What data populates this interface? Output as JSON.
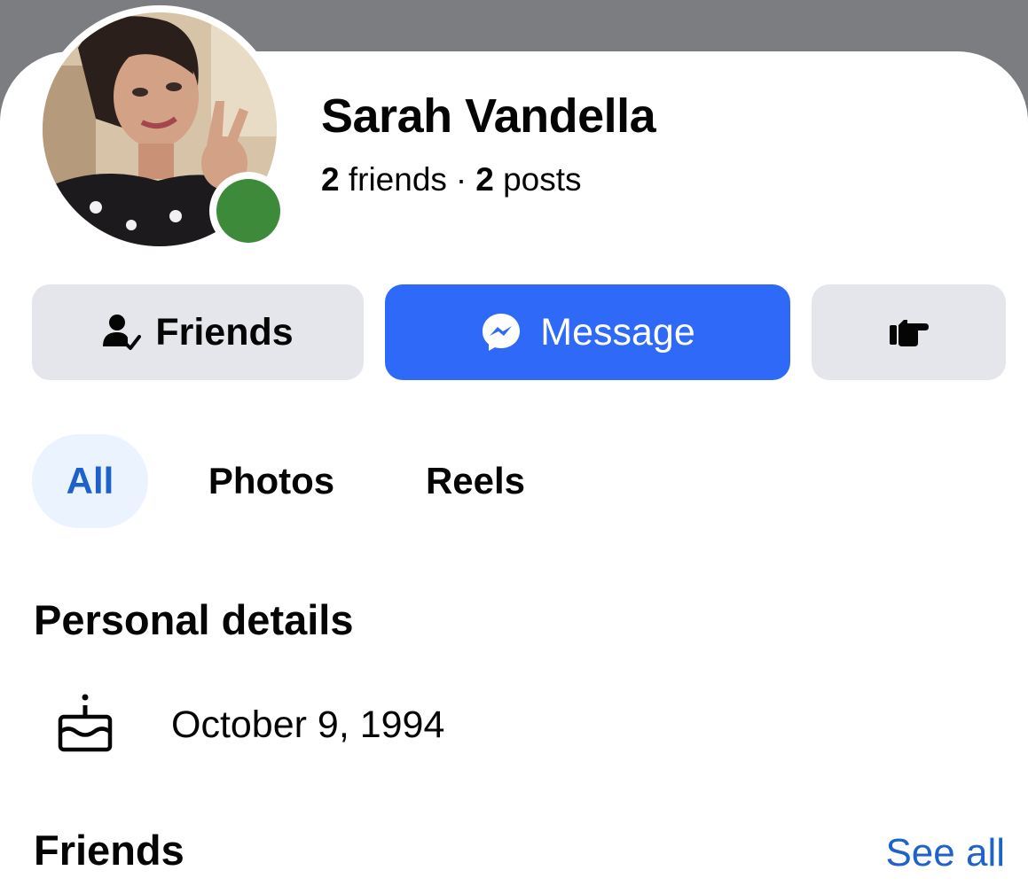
{
  "profile": {
    "name": "Sarah Vandella",
    "friends_count": "2",
    "friends_label": "friends",
    "separator": "·",
    "posts_count": "2",
    "posts_label": "posts",
    "online": true,
    "online_color": "#3c8a3a"
  },
  "actions": {
    "friends_label": "Friends",
    "friends_icon": "friend-check-icon",
    "message_label": "Message",
    "message_icon": "messenger-icon",
    "poke_icon": "poke-hand-icon",
    "message_color": "#2f69f7"
  },
  "tabs": [
    {
      "label": "All",
      "active": true
    },
    {
      "label": "Photos",
      "active": false
    },
    {
      "label": "Reels",
      "active": false
    }
  ],
  "personal_details": {
    "title": "Personal details",
    "birthday_icon": "birthday-cake-icon",
    "birthday": "October 9, 1994"
  },
  "friends_section": {
    "title": "Friends",
    "see_all_label": "See all"
  }
}
